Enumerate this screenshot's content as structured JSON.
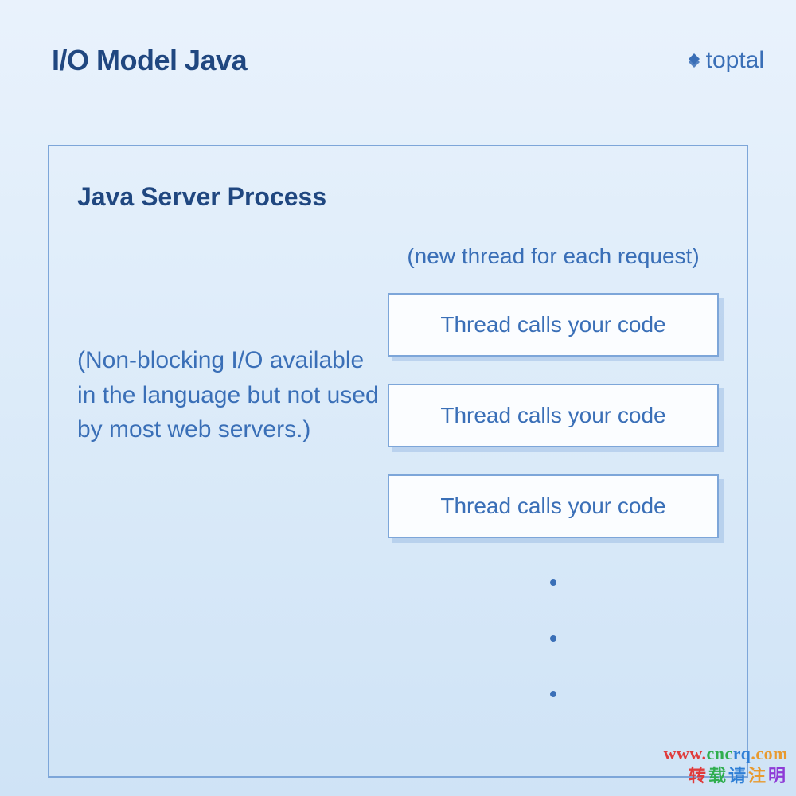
{
  "header": {
    "title": "I/O Model Java",
    "brand": "toptal"
  },
  "diagram": {
    "process_title": "Java Server Process",
    "left_note": "(Non-blocking I/O available in the language but not used by most web servers.)",
    "thread_caption": "(new thread for each request)",
    "thread_boxes": [
      "Thread calls your code",
      "Thread calls your code",
      "Thread calls your code"
    ]
  },
  "watermark": {
    "line1_parts": [
      "www.",
      "cnc",
      "rq",
      ".com"
    ],
    "line2_parts": [
      "转",
      "载",
      "请",
      "注",
      "明"
    ]
  }
}
